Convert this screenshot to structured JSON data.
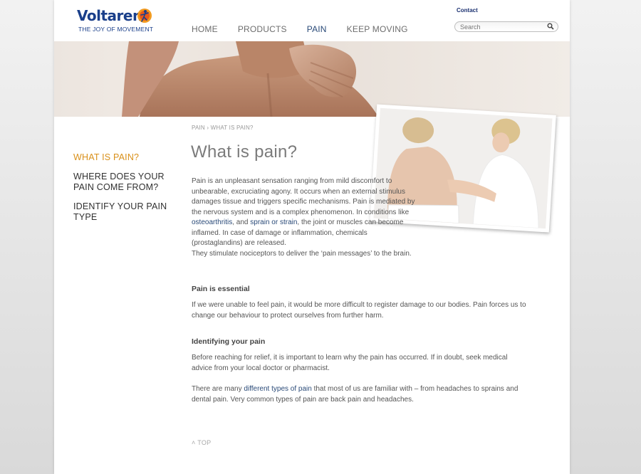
{
  "header": {
    "brand": "Voltaren",
    "tagline": "THE JOY OF MOVEMENT",
    "contact": "Contact",
    "search_placeholder": "Search",
    "nav": [
      "HOME",
      "PRODUCTS",
      "PAIN",
      "KEEP MOVING"
    ]
  },
  "subnav": [
    "WHAT IS PAIN?",
    "WHERE DOES YOUR PAIN COME FROM?",
    "IDENTIFY YOUR PAIN TYPE"
  ],
  "breadcrumb": {
    "parent": "PAIN",
    "separator": "›",
    "current": "WHAT IS PAIN?"
  },
  "content": {
    "title": "What is pain?",
    "p1_a": "Pain is an unpleasant sensation ranging from mild discomfort to unbearable, excruciating agony. It occurs when an external stimulus damages tissue and triggers specific mechanisms. Pain is mediated by the nervous system and is a complex phenomenon. In conditions like ",
    "link_osteoarthritis": "osteoarthritis",
    "p1_b": ", and ",
    "link_sprain": "sprain or strain",
    "p1_c": ", the joint or muscles can become inflamed. In case of damage or inflammation, chemicals (prostaglandins) are released.",
    "p1_d": "They stimulate nociceptors to deliver the ‘pain messages’ to the brain.",
    "h_essential": "Pain is essential",
    "p2": "If we were unable to feel pain, it would be more difficult to register damage to our bodies. Pain forces us to change our behaviour to protect ourselves from further harm.",
    "h_identifying": "Identifying your pain",
    "p3": "Before reaching for relief, it is important to learn why the pain has occurred. If in doubt, seek medical advice from your local doctor or pharmacist.",
    "p4_a": "There are many ",
    "link_types": "different types of pain",
    "p4_b": " that most of us are familiar with – from headaches to sprains and dental pain. Very common types of pain are back pain and headaches.",
    "top": "TOP"
  },
  "colors": {
    "accent": "#d9901a",
    "brand": "#1a3f8a",
    "link": "#2a4a78"
  }
}
